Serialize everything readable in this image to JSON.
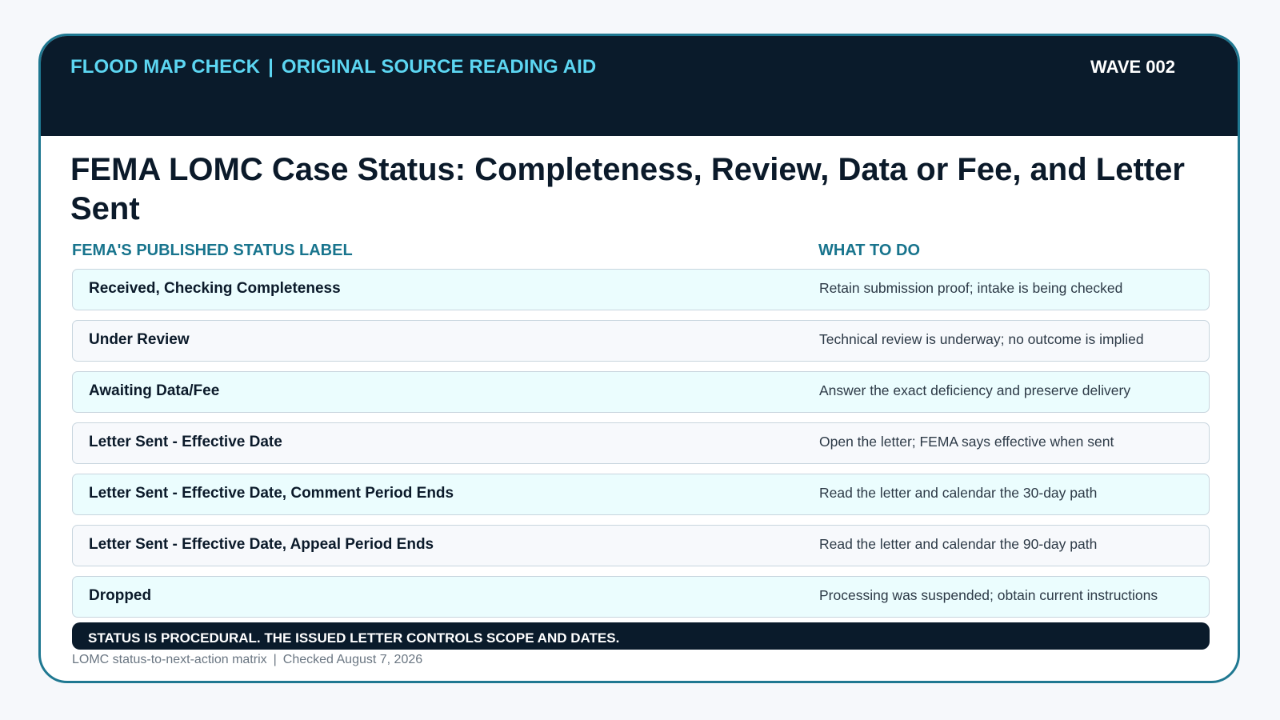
{
  "header": {
    "left_title": "FLOOD MAP CHECK",
    "separator": "|",
    "right_title": "ORIGINAL SOURCE READING AID",
    "wave": "WAVE 002"
  },
  "title": "FEMA LOMC Case Status: Completeness, Review, Data or Fee, and Letter Sent",
  "columns": {
    "status": "FEMA'S PUBLISHED STATUS LABEL",
    "action": "WHAT TO DO"
  },
  "rows": [
    {
      "status": "Received, Checking Completeness",
      "action": "Retain submission proof; intake is being checked"
    },
    {
      "status": "Under Review",
      "action": "Technical review is underway; no outcome is implied"
    },
    {
      "status": "Awaiting Data/Fee",
      "action": "Answer the exact deficiency and preserve delivery"
    },
    {
      "status": "Letter Sent - Effective Date",
      "action": "Open the letter; FEMA says effective when sent"
    },
    {
      "status": "Letter Sent - Effective Date, Comment Period Ends",
      "action": "Read the letter and calendar the 30-day path"
    },
    {
      "status": "Letter Sent - Effective Date, Appeal Period Ends",
      "action": "Read the letter and calendar the 90-day path"
    },
    {
      "status": "Dropped",
      "action": "Processing was suspended; obtain current instructions"
    }
  ],
  "banner": "STATUS IS PROCEDURAL. THE ISSUED LETTER CONTROLS SCOPE AND DATES.",
  "footer": {
    "left": "LOMC status-to-next-action matrix",
    "separator": "|",
    "right": "Checked August 7, 2026"
  },
  "colors": {
    "header_bg": "#0a1b2b",
    "accent_cyan": "#5cd6f2",
    "accent_teal": "#18748d",
    "row_alt_bg": "#ebfdfe",
    "row_bg": "#f7f9fc"
  }
}
